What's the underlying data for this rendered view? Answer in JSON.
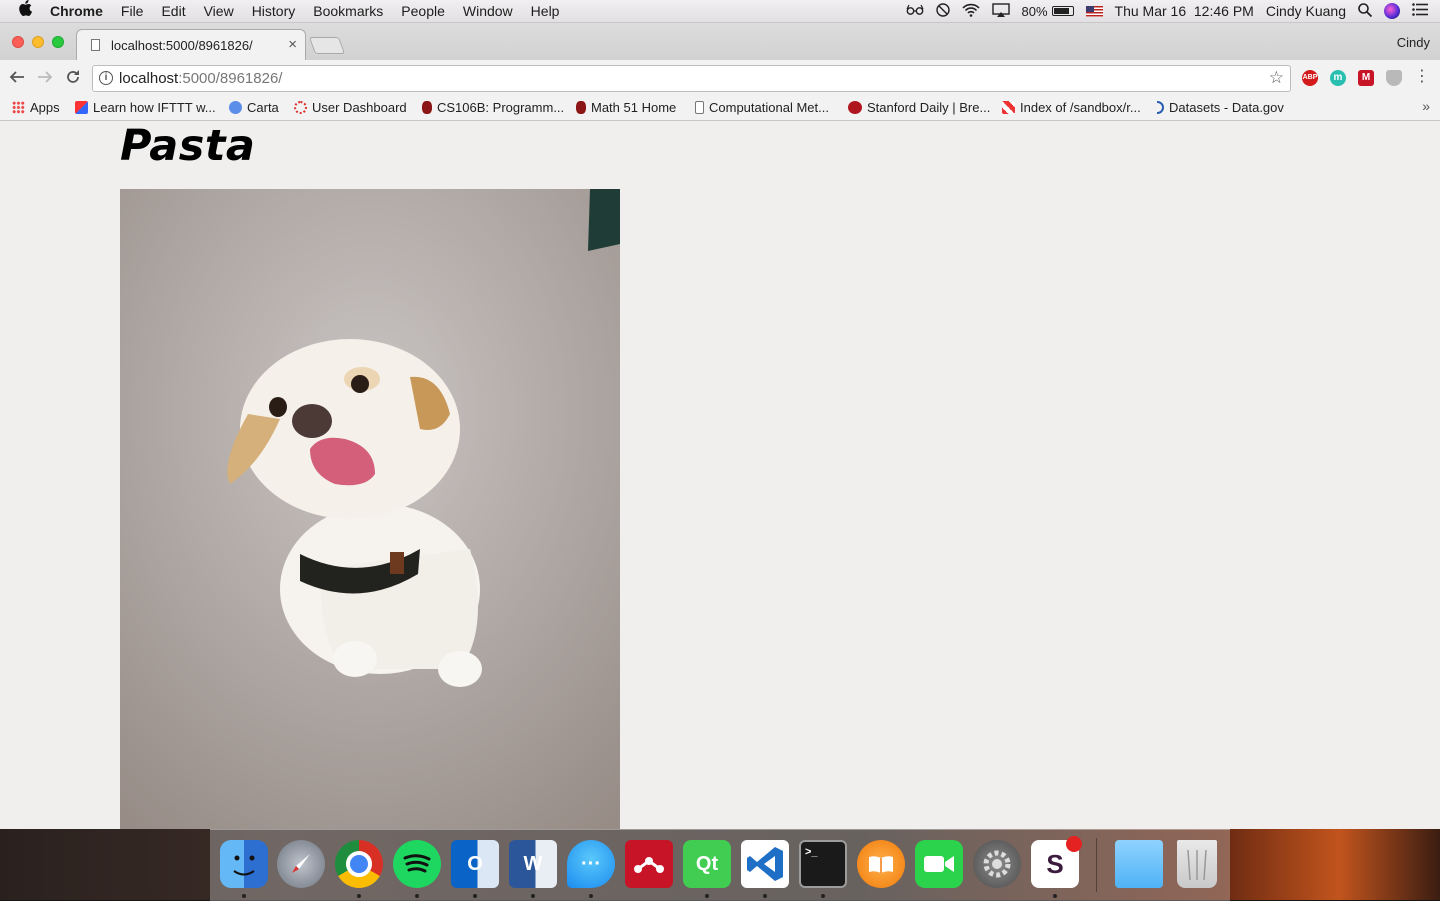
{
  "menubar": {
    "app_name": "Chrome",
    "menus": [
      "File",
      "Edit",
      "View",
      "History",
      "Bookmarks",
      "People",
      "Window",
      "Help"
    ],
    "battery": "80%",
    "datetime": "Thu Mar 16  12:46 PM",
    "user": "Cindy Kuang"
  },
  "browser": {
    "tab_title": "localhost:5000/8961826/",
    "profile": "Cindy",
    "url_host": "localhost",
    "url_path": ":5000/8961826/",
    "bookmarks": [
      {
        "label": "Apps",
        "icon": "apps-grid-icon"
      },
      {
        "label": "Learn how IFTTT w...",
        "icon": "ifttt-icon"
      },
      {
        "label": "Carta",
        "icon": "carta-icon"
      },
      {
        "label": "User Dashboard",
        "icon": "dashboard-icon"
      },
      {
        "label": "CS106B: Programm...",
        "icon": "stanford-icon"
      },
      {
        "label": "Math 51 Home",
        "icon": "stanford-icon"
      },
      {
        "label": "Computational Met...",
        "icon": "page-icon"
      },
      {
        "label": "Stanford Daily | Bre...",
        "icon": "stanford-daily-icon"
      },
      {
        "label": "Index of /sandbox/r...",
        "icon": "index-icon"
      },
      {
        "label": "Datasets - Data.gov",
        "icon": "datagov-icon"
      }
    ],
    "extensions": [
      "ABP",
      "m",
      "M",
      ""
    ]
  },
  "page": {
    "heading": "Pasta"
  },
  "dock": {
    "apps": [
      "Finder",
      "Launchpad",
      "Chrome",
      "Spotify",
      "Outlook",
      "Word",
      "Messages",
      "Mendeley",
      "Qt Creator",
      "Visual Studio Code",
      "Terminal",
      "iBooks",
      "FaceTime",
      "System Preferences",
      "Slack",
      "Downloads",
      "Trash"
    ]
  }
}
